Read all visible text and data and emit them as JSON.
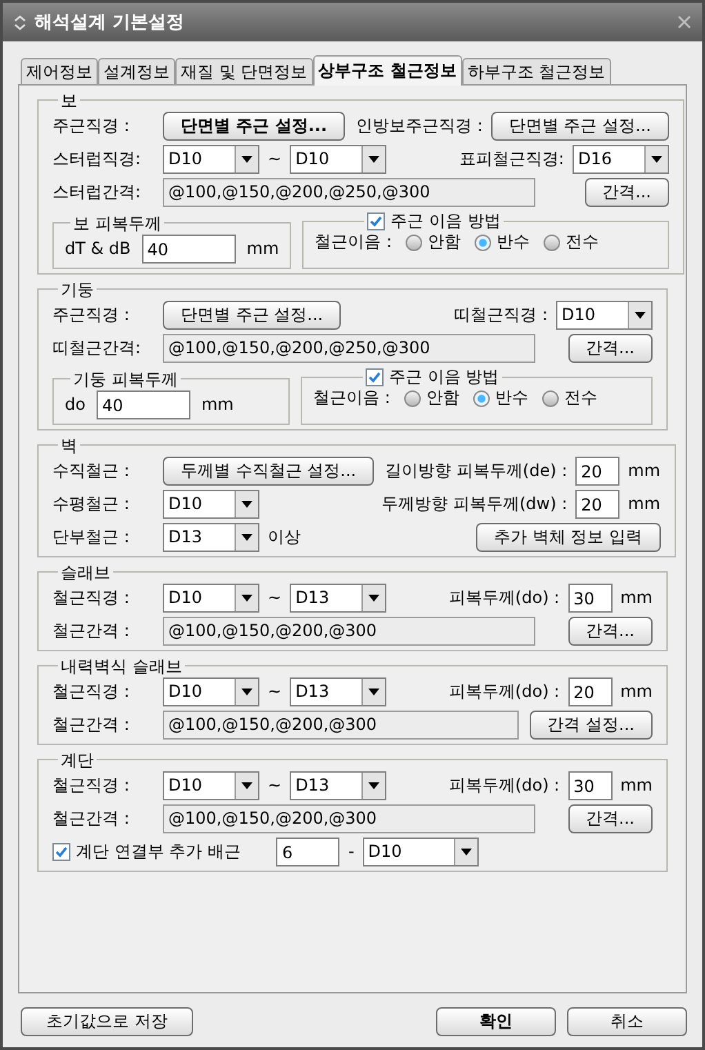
{
  "window": {
    "title": "해석설계 기본설정"
  },
  "tabs": [
    {
      "label": "제어정보",
      "selected": false
    },
    {
      "label": "설계정보",
      "selected": false
    },
    {
      "label": "재질 및 단면정보",
      "selected": false
    },
    {
      "label": "상부구조 철근정보",
      "selected": true
    },
    {
      "label": "하부구조 철근정보",
      "selected": false
    }
  ],
  "sections": [
    {
      "title": "보",
      "rows": [
        {
          "left": [
            {
              "kind": "label",
              "text": "주근직경 :"
            },
            {
              "kind": "button",
              "text": "단면별 주근 설정...",
              "default": true
            }
          ],
          "right": [
            {
              "kind": "label",
              "text": "인방보주근직경 :"
            },
            {
              "kind": "button",
              "text": "단면별 주근 설정...",
              "default": false
            }
          ]
        },
        {
          "left": [
            {
              "kind": "label",
              "text": "스터럽직경:"
            },
            {
              "kind": "select",
              "value": "D10"
            },
            {
              "kind": "label",
              "text": "~"
            },
            {
              "kind": "select",
              "value": "D10"
            }
          ],
          "right": [
            {
              "kind": "label",
              "text": "표피철근직경:"
            },
            {
              "kind": "select",
              "value": "D16"
            }
          ]
        },
        {
          "left": [
            {
              "kind": "label",
              "text": "스터럽간격:"
            },
            {
              "kind": "readonly",
              "value": "@100,@150,@200,@250,@300"
            }
          ],
          "right": [
            {
              "kind": "button",
              "text": "간격...",
              "default": false
            }
          ]
        },
        {
          "groups": [
            {
              "kind": "plain",
              "title": "보 피복두께",
              "items": [
                {
                  "kind": "label",
                  "text": "dT & dB"
                },
                {
                  "kind": "field",
                  "value": "40"
                },
                {
                  "kind": "label",
                  "text": "mm"
                }
              ]
            },
            {
              "kind": "checkbox",
              "title": "주근 이음 방법",
              "checked": true,
              "items": [
                {
                  "kind": "label",
                  "text": "철근이음 :"
                },
                {
                  "kind": "radio",
                  "text": "안함",
                  "selected": false
                },
                {
                  "kind": "radio",
                  "text": "반수",
                  "selected": true
                },
                {
                  "kind": "radio",
                  "text": "전수",
                  "selected": false
                }
              ]
            }
          ]
        }
      ]
    },
    {
      "title": "기둥",
      "rows": [
        {
          "left": [
            {
              "kind": "label",
              "text": "주근직경 :"
            },
            {
              "kind": "button",
              "text": "단면별 주근 설정...",
              "default": false
            }
          ],
          "right": [
            {
              "kind": "label",
              "text": "띠철근직경 :"
            },
            {
              "kind": "select",
              "value": "D10"
            }
          ]
        },
        {
          "left": [
            {
              "kind": "label",
              "text": "띠철근간격:"
            },
            {
              "kind": "readonly",
              "value": "@100,@150,@200,@250,@300"
            }
          ],
          "right": [
            {
              "kind": "button",
              "text": "간격...",
              "default": false
            }
          ]
        },
        {
          "groups": [
            {
              "kind": "plain",
              "title": "기둥 피복두께",
              "items": [
                {
                  "kind": "label",
                  "text": "do"
                },
                {
                  "kind": "field",
                  "value": "40"
                },
                {
                  "kind": "label",
                  "text": "mm"
                }
              ]
            },
            {
              "kind": "checkbox",
              "title": "주근 이음 방법",
              "checked": true,
              "items": [
                {
                  "kind": "label",
                  "text": "철근이음 :"
                },
                {
                  "kind": "radio",
                  "text": "안함",
                  "selected": false
                },
                {
                  "kind": "radio",
                  "text": "반수",
                  "selected": true
                },
                {
                  "kind": "radio",
                  "text": "전수",
                  "selected": false
                }
              ]
            }
          ]
        }
      ]
    },
    {
      "title": "벽",
      "rows": [
        {
          "left": [
            {
              "kind": "label",
              "text": "수직철근 :"
            },
            {
              "kind": "button",
              "text": "두께별 수직철근 설정...",
              "default": false
            }
          ],
          "right": [
            {
              "kind": "label",
              "text": "길이방향 피복두께(de) :"
            },
            {
              "kind": "field",
              "value": "20"
            },
            {
              "kind": "label",
              "text": "mm"
            }
          ]
        },
        {
          "left": [
            {
              "kind": "label",
              "text": "수평철근 :"
            },
            {
              "kind": "select",
              "value": "D10"
            }
          ],
          "right": [
            {
              "kind": "label",
              "text": "두께방향 피복두께(dw) :"
            },
            {
              "kind": "field",
              "value": "20"
            },
            {
              "kind": "label",
              "text": "mm"
            }
          ]
        },
        {
          "left": [
            {
              "kind": "label",
              "text": "단부철근 :"
            },
            {
              "kind": "select",
              "value": "D13"
            },
            {
              "kind": "label",
              "text": "이상"
            }
          ],
          "right": [
            {
              "kind": "button",
              "text": "추가 벽체 정보 입력",
              "default": false
            }
          ]
        }
      ]
    },
    {
      "title": "슬래브",
      "rows": [
        {
          "left": [
            {
              "kind": "label",
              "text": "철근직경 :"
            },
            {
              "kind": "select",
              "value": "D10"
            },
            {
              "kind": "label",
              "text": "~"
            },
            {
              "kind": "select",
              "value": "D13"
            }
          ],
          "right": [
            {
              "kind": "label",
              "text": "피복두께(do) :"
            },
            {
              "kind": "field",
              "value": "30"
            },
            {
              "kind": "label",
              "text": "mm"
            }
          ]
        },
        {
          "left": [
            {
              "kind": "label",
              "text": "철근간격 :"
            },
            {
              "kind": "readonly",
              "value": "@100,@150,@200,@300"
            }
          ],
          "right": [
            {
              "kind": "button",
              "text": "간격...",
              "default": false
            }
          ]
        }
      ]
    },
    {
      "title": "내력벽식 슬래브",
      "rows": [
        {
          "left": [
            {
              "kind": "label",
              "text": "철근직경 :"
            },
            {
              "kind": "select",
              "value": "D10"
            },
            {
              "kind": "label",
              "text": "~"
            },
            {
              "kind": "select",
              "value": "D13"
            }
          ],
          "right": [
            {
              "kind": "label",
              "text": "피복두께(do) :"
            },
            {
              "kind": "field",
              "value": "20"
            },
            {
              "kind": "label",
              "text": "mm"
            }
          ]
        },
        {
          "left": [
            {
              "kind": "label",
              "text": "철근간격 :"
            },
            {
              "kind": "readonly",
              "value": "@100,@150,@200,@300"
            }
          ],
          "right": [
            {
              "kind": "button",
              "text": "간격 설정...",
              "default": false
            }
          ]
        }
      ]
    },
    {
      "title": "계단",
      "rows": [
        {
          "left": [
            {
              "kind": "label",
              "text": "철근직경 :"
            },
            {
              "kind": "select",
              "value": "D10"
            },
            {
              "kind": "label",
              "text": "~"
            },
            {
              "kind": "select",
              "value": "D13"
            }
          ],
          "right": [
            {
              "kind": "label",
              "text": "피복두께(do) :"
            },
            {
              "kind": "field",
              "value": "30"
            },
            {
              "kind": "label",
              "text": "mm"
            }
          ]
        },
        {
          "left": [
            {
              "kind": "label",
              "text": "철근간격 :"
            },
            {
              "kind": "readonly",
              "value": "@100,@150,@200,@300"
            }
          ],
          "right": [
            {
              "kind": "button",
              "text": "간격...",
              "default": false
            }
          ]
        },
        {
          "left": [
            {
              "kind": "checkbox",
              "text": "계단 연결부 추가 배근",
              "checked": true
            },
            {
              "kind": "field",
              "value": "6"
            },
            {
              "kind": "label",
              "text": "-"
            },
            {
              "kind": "select",
              "value": "D10"
            }
          ]
        }
      ]
    }
  ],
  "buttons": [
    {
      "text": "초기값으로 저장",
      "default": false
    },
    {
      "text": "확인",
      "default": true
    },
    {
      "text": "취소",
      "default": false
    }
  ]
}
